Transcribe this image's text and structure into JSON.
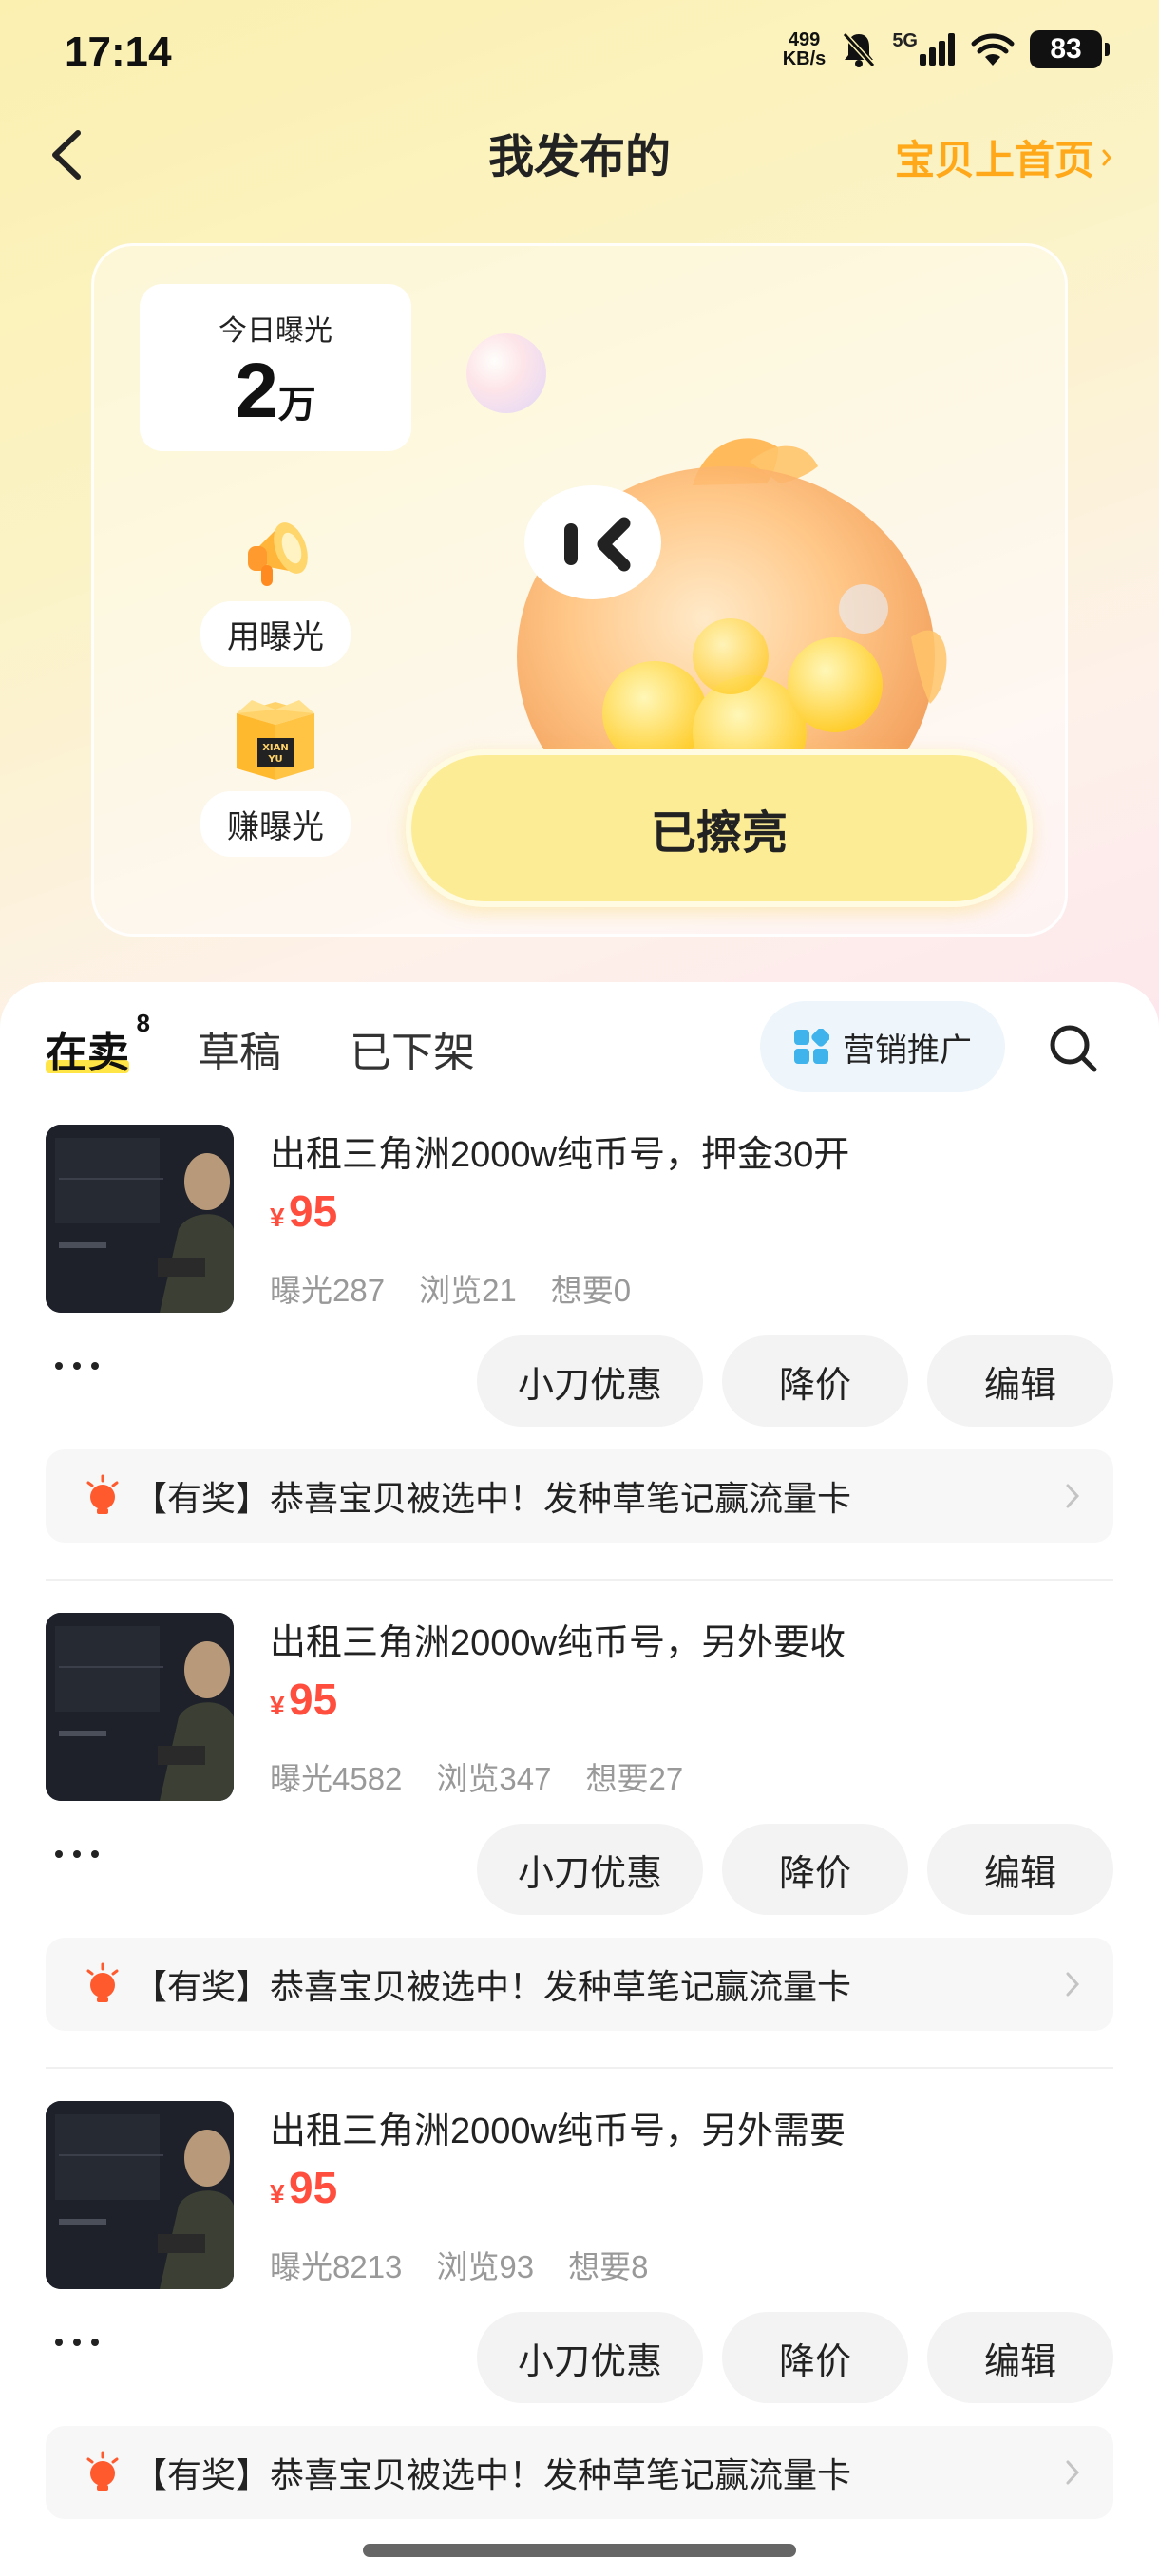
{
  "status_bar": {
    "time": "17:14",
    "net_speed_value": "499",
    "net_speed_unit": "KB/s",
    "network": "5G",
    "battery": "83"
  },
  "nav": {
    "title": "我发布的",
    "right_link": "宝贝上首页"
  },
  "hero": {
    "exposure_label": "今日曝光",
    "exposure_value": "2",
    "exposure_unit": "万",
    "use_exposure": "用曝光",
    "earn_exposure": "赚曝光",
    "box_label_line1": "XIAN",
    "box_label_line2": "YU",
    "primary_button": "已擦亮"
  },
  "tabs": {
    "selling": "在卖",
    "selling_count": "8",
    "drafts": "草稿",
    "removed": "已下架",
    "promo": "营销推广"
  },
  "items": [
    {
      "title": "出租三角洲2000w纯币号，押金30开",
      "currency": "¥",
      "price": "95",
      "exposure": "曝光287",
      "views": "浏览21",
      "wants": "想要0",
      "btn_coupon": "小刀优惠",
      "btn_reduce": "降价",
      "btn_edit": "编辑",
      "notice": "【有奖】恭喜宝贝被选中！发种草笔记赢流量卡"
    },
    {
      "title": "出租三角洲2000w纯币号，另外要收",
      "currency": "¥",
      "price": "95",
      "exposure": "曝光4582",
      "views": "浏览347",
      "wants": "想要27",
      "btn_coupon": "小刀优惠",
      "btn_reduce": "降价",
      "btn_edit": "编辑",
      "notice": "【有奖】恭喜宝贝被选中！发种草笔记赢流量卡"
    },
    {
      "title": "出租三角洲2000w纯币号，另外需要",
      "currency": "¥",
      "price": "95",
      "exposure": "曝光8213",
      "views": "浏览93",
      "wants": "想要8",
      "btn_coupon": "小刀优惠",
      "btn_reduce": "降价",
      "btn_edit": "编辑",
      "notice": "【有奖】恭喜宝贝被选中！发种草笔记赢流量卡"
    }
  ],
  "colors": {
    "accent_orange": "#ffa81a",
    "price_red": "#ff4e3e",
    "highlight_yellow": "#ffe545",
    "button_yellow": "#fdec96"
  },
  "icons": [
    "back-arrow-icon",
    "mute-bell-icon",
    "signal-icon",
    "wifi-icon",
    "megaphone-icon",
    "gift-box-icon",
    "grid-icon",
    "search-icon",
    "more-dots-icon",
    "lightbulb-icon",
    "chevron-right-icon"
  ]
}
